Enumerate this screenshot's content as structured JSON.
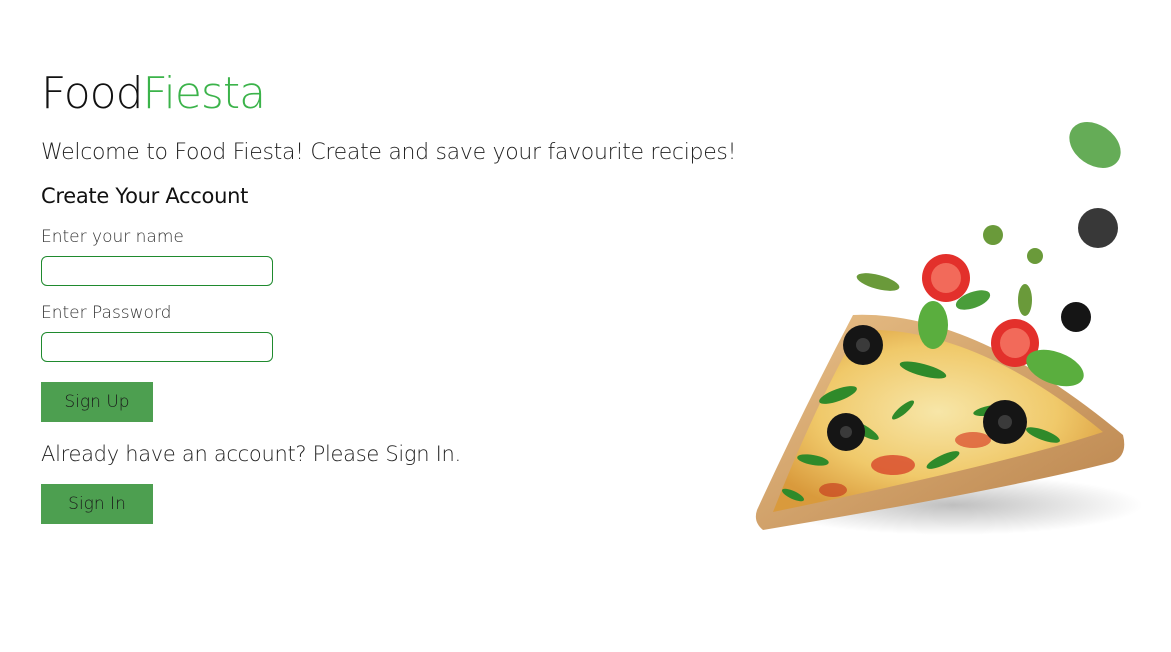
{
  "brand": {
    "name_part1": "Food",
    "name_part2": "Fiesta",
    "accent_color": "#3bb34a"
  },
  "welcome_text": "Welcome to Food Fiesta! Create and save your favourite recipes!",
  "form": {
    "heading": "Create Your Account",
    "name_label": "Enter your name",
    "name_value": "",
    "password_label": "Enter Password",
    "password_value": "",
    "signup_label": "Sign Up"
  },
  "signin": {
    "prompt": "Already have an account? Please Sign In.",
    "button_label": "Sign In"
  },
  "colors": {
    "button_bg": "#4d9f50",
    "input_border": "#1f8a2e"
  },
  "image": {
    "subject": "pizza-slice"
  }
}
